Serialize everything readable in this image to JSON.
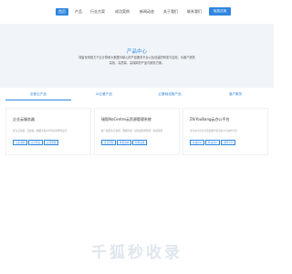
{
  "nav": {
    "items": [
      "首页",
      "产品",
      "行业方案",
      "成功案例",
      "新闻动态",
      "关于我们",
      "联系我们"
    ],
    "cta_label": "免费试用"
  },
  "hero": {
    "title": "产品中心",
    "description": "瑞智优帮致力于云计算和大数据为核心的产品服务平台以及自建的研发与应用，为客户提供高效、高质量、高保障的产品与服务方案。"
  },
  "tabs": [
    "全部云产品",
    "AI云管产品",
    "云基础设施产品",
    "落户服务"
  ],
  "cards": [
    {
      "title": "企业云服务器",
      "description": "专为云存储、云建站、数据库和APP等应用场景设计",
      "buttons": [
        "可定制化",
        "安全稳定",
        "灵活配置"
      ]
    },
    {
      "title": "瑞智NoCentre云资源管理系统",
      "description": "统一纳管多云资源，数据可视，提供运维管理等一站式服务",
      "buttons": [
        "多云管理",
        "降低成本",
        "智能运维"
      ]
    },
    {
      "title": "ZhiYouBang云办公平台",
      "description": "专为中小企业打造的数字化云办公与协作平台",
      "buttons": [
        "在线办公",
        "移动办公",
        "协同共享"
      ]
    }
  ],
  "footer": {
    "logo_text": "千狐秒收录"
  },
  "colors": {
    "accent": "#2f87e0",
    "hero_bg": "#f1f5f9"
  }
}
